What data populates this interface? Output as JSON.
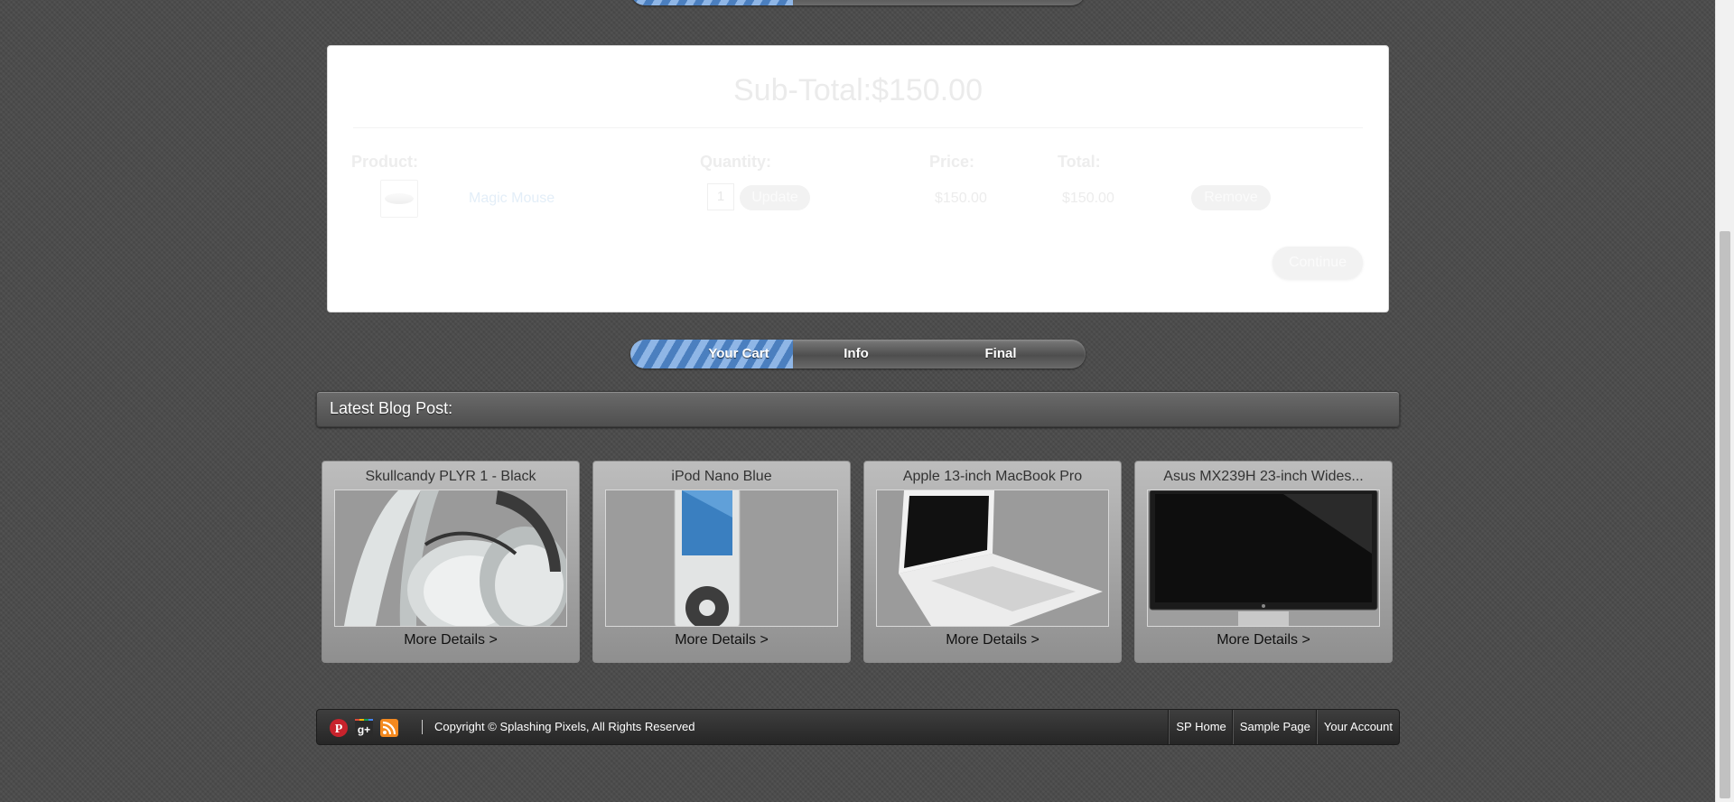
{
  "steps": [
    {
      "label": "Your Cart",
      "active": true
    },
    {
      "label": "Info",
      "active": false
    },
    {
      "label": "Final",
      "active": false
    }
  ],
  "cart": {
    "subtotal": "Sub-Total:$150.00",
    "headers": {
      "product": "Product:",
      "quantity": "Quantity:",
      "price": "Price:",
      "total": "Total:"
    },
    "items": [
      {
        "name": "Magic Mouse",
        "quantity": "1",
        "price": "$150.00",
        "total": "$150.00"
      }
    ],
    "update_label": "Update",
    "remove_label": "Remove",
    "continue_label": "Continue"
  },
  "blog": {
    "header": "Latest Blog Post:"
  },
  "products": [
    {
      "title": "Skullcandy PLYR 1 - Black",
      "link": "More Details >",
      "image_icon": "headphones-image"
    },
    {
      "title": "iPod Nano Blue",
      "link": "More Details >",
      "image_icon": "ipod-image"
    },
    {
      "title": "Apple 13-inch MacBook Pro",
      "link": "More Details >",
      "image_icon": "laptop-image"
    },
    {
      "title": "Asus MX239H 23-inch Wides...",
      "link": "More Details >",
      "image_icon": "monitor-image"
    }
  ],
  "footer": {
    "social_icons": [
      "pinterest-icon",
      "google-plus-icon",
      "rss-icon"
    ],
    "copyright": "Copyright © Splashing Pixels, All Rights Reserved",
    "links": [
      "SP Home",
      "Sample Page",
      "Your Account"
    ]
  },
  "colors": {
    "step_active": "#8fb6e6",
    "background": "#4a4a4a"
  }
}
